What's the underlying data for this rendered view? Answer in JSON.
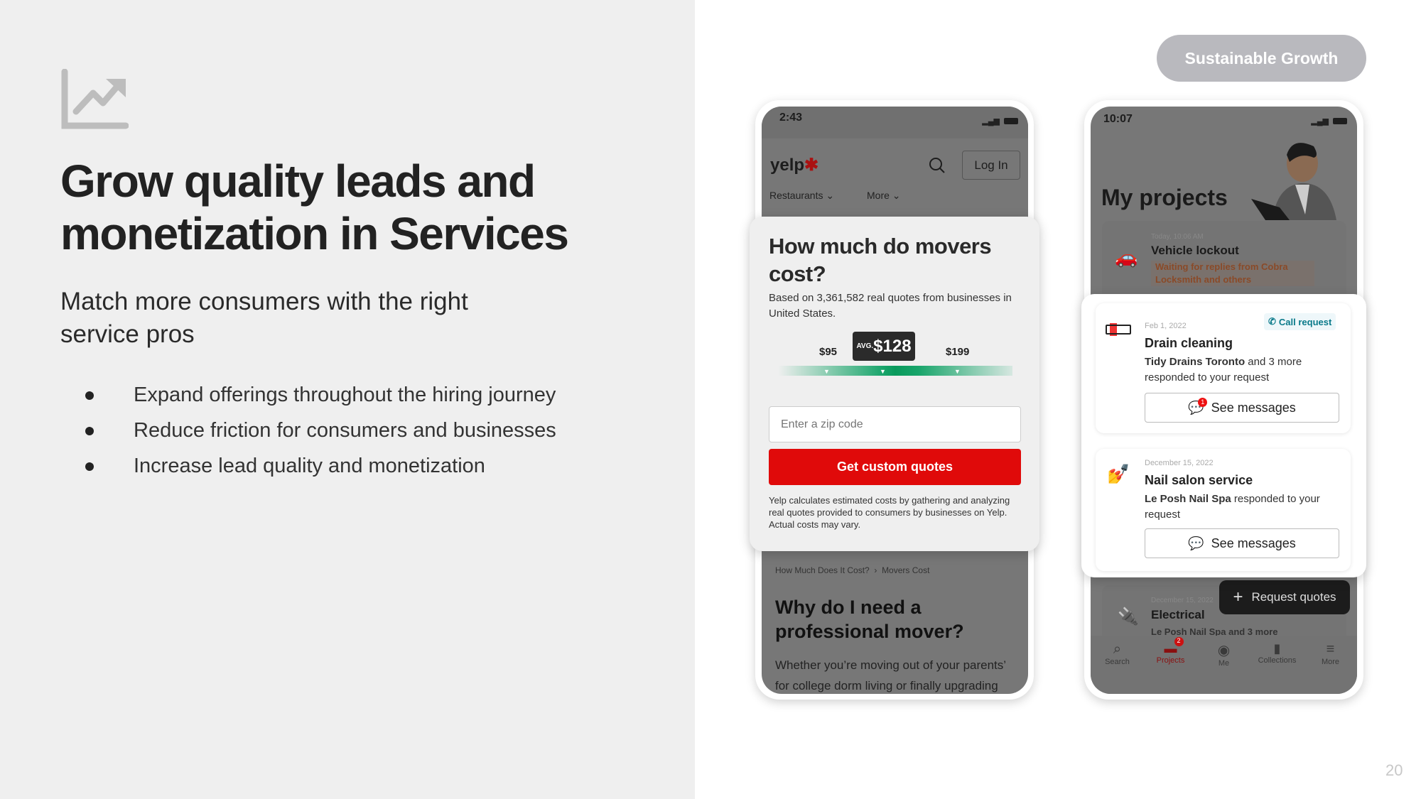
{
  "slide": {
    "icon": "trending-chart-icon",
    "title": "Grow quality leads and monetization in Services",
    "subtitle": "Match more consumers with the right service pros",
    "bullets": [
      "Expand offerings throughout the hiring journey",
      "Reduce friction for consumers and businesses",
      "Increase lead quality and monetization"
    ],
    "badge": "Sustainable Growth",
    "page_number": "20"
  },
  "phone1": {
    "time": "2:43",
    "logo": "yelp",
    "login": "Log In",
    "nav": [
      "Restaurants",
      "More"
    ],
    "title": "How much do movers cost?",
    "based_on": "Based on 3,361,582 real quotes from businesses in United States.",
    "low": "$95",
    "avg_label": "AVG.",
    "avg": "$128",
    "high": "$199",
    "zip_placeholder": "Enter a zip code",
    "cta": "Get custom quotes",
    "disclaimer": "Yelp calculates estimated costs by gathering and analyzing real quotes provided to consumers by businesses on Yelp. Actual costs may vary.",
    "breadcrumb": [
      "How Much Does It Cost?",
      "Movers Cost"
    ],
    "section_title": "Why do I need a professional mover?",
    "section_body": "Whether you’re moving out of your parents’ for college dorm living or finally upgrading"
  },
  "phone2": {
    "time": "10:07",
    "title": "My projects",
    "vehicle": {
      "date": "Today, 10:06 AM",
      "title": "Vehicle lockout",
      "status": "Waiting for replies from Cobra Locksmith and others"
    },
    "drain": {
      "date": "Feb 1, 2022",
      "tag": "Call request",
      "title": "Drain cleaning",
      "bold": "Tidy Drains Toronto",
      "rest": " and 3 more responded to your request",
      "button": "See messages",
      "badge": "1"
    },
    "nail": {
      "date": "December 15, 2022",
      "title": "Nail salon service",
      "bold": "Le Posh Nail Spa",
      "rest": " responded to your request",
      "button": "See messages"
    },
    "electrical": {
      "date": "December 15, 2022",
      "title": "Electrical",
      "body": "Le Posh Nail Spa and 3 more"
    },
    "fab": "Request quotes",
    "tabs": [
      {
        "label": "Search",
        "icon": "search-icon"
      },
      {
        "label": "Projects",
        "icon": "projects-icon",
        "badge": "2"
      },
      {
        "label": "Me",
        "icon": "profile-icon"
      },
      {
        "label": "Collections",
        "icon": "bookmark-icon"
      },
      {
        "label": "More",
        "icon": "menu-icon"
      }
    ],
    "accent": "#d32323"
  }
}
